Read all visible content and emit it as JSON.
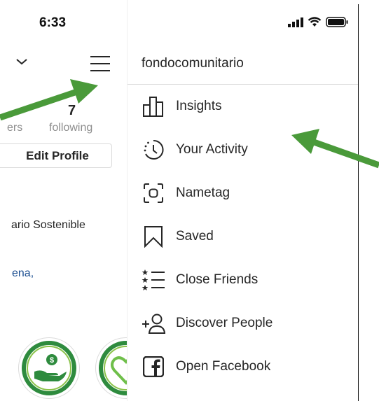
{
  "status_bar": {
    "time": "6:33"
  },
  "profile": {
    "stats_partial_label": "ers",
    "following_count": "7",
    "following_label": "following",
    "edit_profile_label": "Edit Profile",
    "bio_name": "ario Sostenible",
    "bio_link": "ena,"
  },
  "drawer": {
    "username": "fondocomunitario",
    "menu": [
      {
        "label": "Insights",
        "icon": "insights-icon"
      },
      {
        "label": "Your Activity",
        "icon": "activity-clock-icon"
      },
      {
        "label": "Nametag",
        "icon": "nametag-icon"
      },
      {
        "label": "Saved",
        "icon": "bookmark-icon"
      },
      {
        "label": "Close Friends",
        "icon": "close-friends-list-icon"
      },
      {
        "label": "Discover People",
        "icon": "add-person-icon"
      },
      {
        "label": "Open Facebook",
        "icon": "facebook-icon"
      }
    ]
  },
  "colors": {
    "text": "#262626",
    "muted": "#8e8e8e",
    "link": "#1d4f91",
    "arrow": "#4a9a3a",
    "highlight_green": "#2e8b3e"
  }
}
